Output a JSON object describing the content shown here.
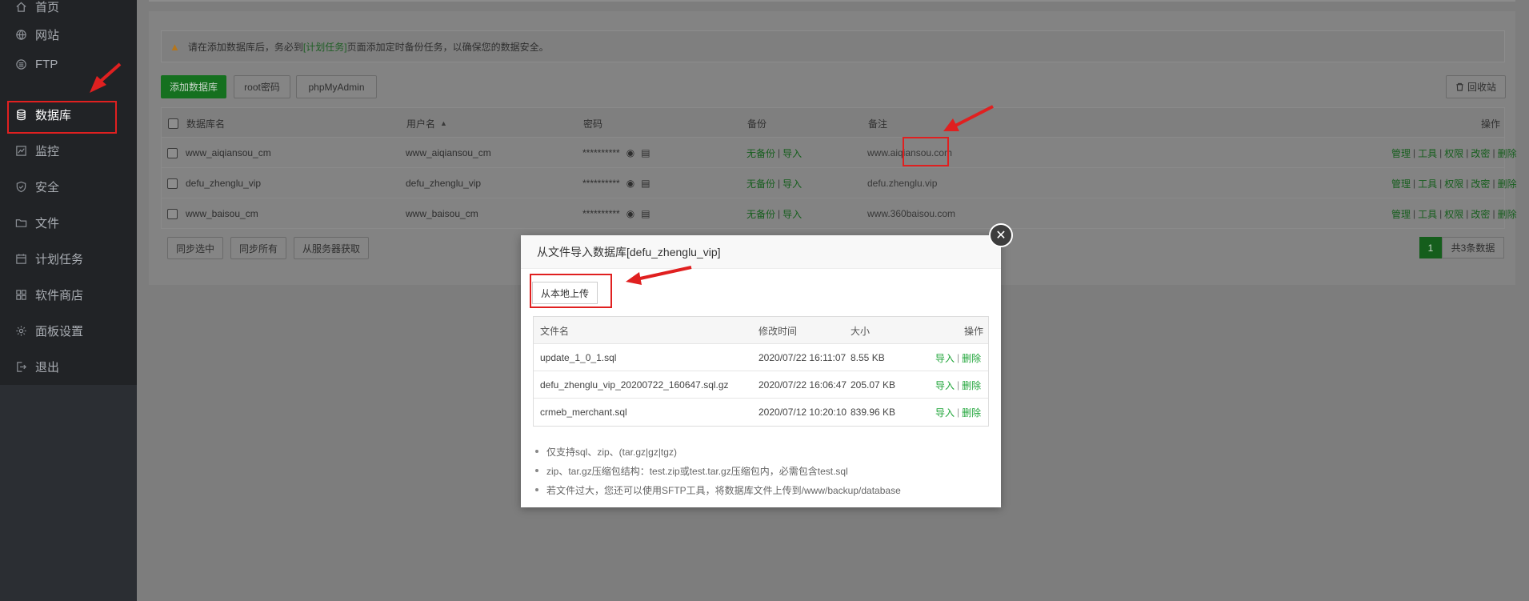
{
  "sidebar": {
    "items": [
      {
        "label": "首页",
        "icon": "home-icon"
      },
      {
        "label": "网站",
        "icon": "globe-icon"
      },
      {
        "label": "FTP",
        "icon": "server-icon"
      },
      {
        "label": "数据库",
        "icon": "database-icon"
      },
      {
        "label": "监控",
        "icon": "monitor-icon"
      },
      {
        "label": "安全",
        "icon": "shield-icon"
      },
      {
        "label": "文件",
        "icon": "folder-icon"
      },
      {
        "label": "计划任务",
        "icon": "calendar-icon"
      },
      {
        "label": "软件商店",
        "icon": "apps-icon"
      },
      {
        "label": "面板设置",
        "icon": "gear-icon"
      },
      {
        "label": "退出",
        "icon": "logout-icon"
      }
    ]
  },
  "notice": {
    "prefix": "请在添加数据库后，务必到",
    "link": "[计划任务]",
    "suffix": "页面添加定时备份任务，以确保您的数据安全。"
  },
  "toolbar": {
    "add_db": "添加数据库",
    "root_pwd": "root密码",
    "phpmyadmin": "phpMyAdmin",
    "recycle": "回收站"
  },
  "table": {
    "headers": {
      "name": "数据库名",
      "user": "用户名",
      "pwd": "密码",
      "backup": "备份",
      "note": "备注",
      "ops": "操作"
    },
    "rows": [
      {
        "name": "www_aiqiansou_cm",
        "user": "www_aiqiansou_cm",
        "pwd": "**********",
        "backup": "无备份",
        "import": "导入",
        "note": "www.aiqiansou.com"
      },
      {
        "name": "defu_zhenglu_vip",
        "user": "defu_zhenglu_vip",
        "pwd": "**********",
        "backup": "无备份",
        "import": "导入",
        "note": "defu.zhenglu.vip"
      },
      {
        "name": "www_baisou_cm",
        "user": "www_baisou_cm",
        "pwd": "**********",
        "backup": "无备份",
        "import": "导入",
        "note": "www.360baisou.com"
      }
    ],
    "ops": {
      "manage": "管理",
      "tools": "工具",
      "perm": "权限",
      "chpwd": "改密",
      "delete": "删除"
    }
  },
  "bottom": {
    "sync_selected": "同步选中",
    "sync_all": "同步所有",
    "from_server": "从服务器获取",
    "page": "1",
    "total": "共3条数据"
  },
  "modal": {
    "title": "从文件导入数据库[defu_zhenglu_vip]",
    "upload": "从本地上传",
    "headers": {
      "file": "文件名",
      "mtime": "修改时间",
      "size": "大小",
      "ops": "操作"
    },
    "files": [
      {
        "name": "update_1_0_1.sql",
        "mtime": "2020/07/22 16:11:07",
        "size": "8.55 KB"
      },
      {
        "name": "defu_zhenglu_vip_20200722_160647.sql.gz",
        "mtime": "2020/07/22 16:06:47",
        "size": "205.07 KB"
      },
      {
        "name": "crmeb_merchant.sql",
        "mtime": "2020/07/12 10:20:10",
        "size": "839.96 KB"
      }
    ],
    "file_ops": {
      "import": "导入",
      "delete": "删除"
    },
    "tips": [
      "仅支持sql、zip、(tar.gz|gz|tgz)",
      "zip、tar.gz压缩包结构：test.zip或test.tar.gz压缩包内，必需包含test.sql",
      "若文件过大，您还可以使用SFTP工具，将数据库文件上传到/www/backup/database"
    ]
  },
  "colors": {
    "accent": "#20a53a",
    "annotation": "#e02020"
  }
}
